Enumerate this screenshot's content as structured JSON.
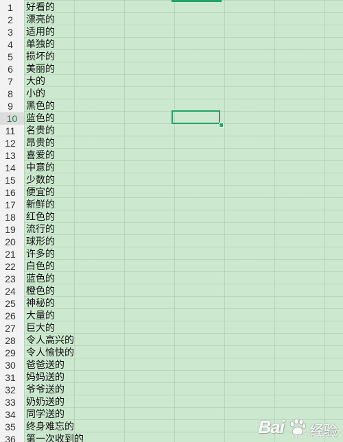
{
  "sheet": {
    "active_row": 10,
    "rows": [
      {
        "num": "1",
        "text": "好看的"
      },
      {
        "num": "2",
        "text": "漂亮的"
      },
      {
        "num": "3",
        "text": "适用的"
      },
      {
        "num": "4",
        "text": "单独的"
      },
      {
        "num": "5",
        "text": "损坏的"
      },
      {
        "num": "6",
        "text": "美丽的"
      },
      {
        "num": "7",
        "text": "大的"
      },
      {
        "num": "8",
        "text": "小的"
      },
      {
        "num": "9",
        "text": "黑色的"
      },
      {
        "num": "10",
        "text": "蓝色的"
      },
      {
        "num": "11",
        "text": "名贵的"
      },
      {
        "num": "12",
        "text": "昂贵的"
      },
      {
        "num": "13",
        "text": "喜爱的"
      },
      {
        "num": "14",
        "text": "中意的"
      },
      {
        "num": "15",
        "text": "少数的"
      },
      {
        "num": "16",
        "text": "便宜的"
      },
      {
        "num": "17",
        "text": "新鲜的"
      },
      {
        "num": "18",
        "text": "红色的"
      },
      {
        "num": "19",
        "text": "流行的"
      },
      {
        "num": "20",
        "text": "球形的"
      },
      {
        "num": "21",
        "text": "许多的"
      },
      {
        "num": "22",
        "text": "白色的"
      },
      {
        "num": "23",
        "text": "蓝色的"
      },
      {
        "num": "24",
        "text": "橙色的"
      },
      {
        "num": "25",
        "text": "神秘的"
      },
      {
        "num": "26",
        "text": "大量的"
      },
      {
        "num": "27",
        "text": "巨大的"
      },
      {
        "num": "28",
        "text": "令人高兴的"
      },
      {
        "num": "29",
        "text": "令人愉快的"
      },
      {
        "num": "30",
        "text": "爸爸送的"
      },
      {
        "num": "31",
        "text": "妈妈送的"
      },
      {
        "num": "32",
        "text": "爷爷送的"
      },
      {
        "num": "33",
        "text": "奶奶送的"
      },
      {
        "num": "34",
        "text": "同学送的"
      },
      {
        "num": "35",
        "text": "终身难忘的"
      },
      {
        "num": "36",
        "text": "第一次收到的"
      }
    ]
  },
  "watermark": {
    "brand": "Bai",
    "suffix": "经验",
    "url": "jingyan.baidu.com"
  },
  "colors": {
    "cell_background": "#cce8cf",
    "selection_border": "#21a366",
    "row_header_background": "#f2f2f2"
  }
}
